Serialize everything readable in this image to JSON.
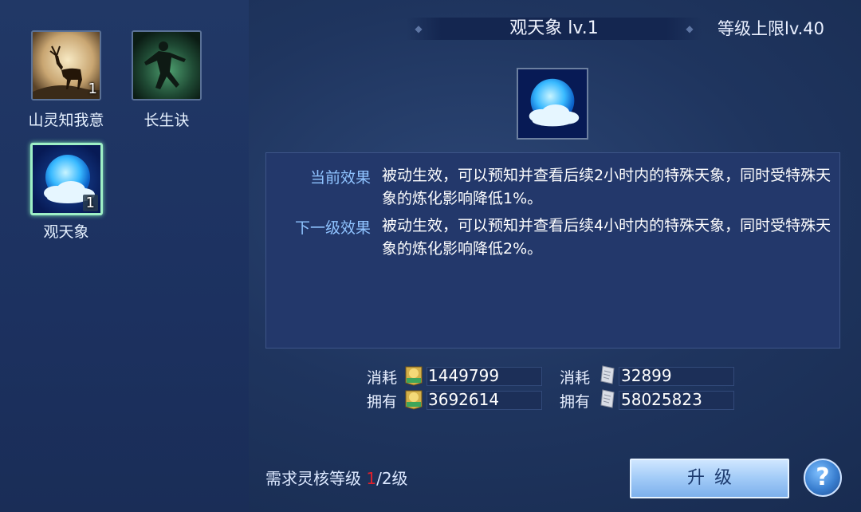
{
  "skills": [
    {
      "name": "山灵知我意",
      "count": "1",
      "icon": "deer-icon"
    },
    {
      "name": "长生诀",
      "count": "",
      "icon": "martial-artist-icon"
    },
    {
      "name": "观天象",
      "count": "1",
      "icon": "moon-cloud-icon"
    }
  ],
  "header": {
    "title": "观天象 lv.1",
    "level_cap": "等级上限lv.40"
  },
  "effects": {
    "current_label": "当前效果",
    "current_text": "被动生效，可以预知并查看后续2小时内的特殊天象，同时受特殊天象的炼化影响降低1%。",
    "next_label": "下一级效果",
    "next_text": "被动生效，可以预知并查看后续4小时内的特殊天象，同时受特殊天象的炼化影响降低2%。"
  },
  "resources": {
    "consume_label": "消耗",
    "own_label": "拥有",
    "exp_consume": "1449799",
    "exp_own": "3692614",
    "scroll_consume": "32899",
    "scroll_own": "58025823",
    "exp_icon": "exp-token-icon",
    "scroll_icon": "scroll-icon"
  },
  "requirement": {
    "label": "需求灵核等级",
    "current": "1",
    "rest": "/2级"
  },
  "buttons": {
    "upgrade": "升级",
    "help": "?"
  },
  "colors": {
    "selected_border": "#9ef0c6",
    "requirement_current": "#e0202a",
    "effect_label": "#8fc3ff"
  }
}
